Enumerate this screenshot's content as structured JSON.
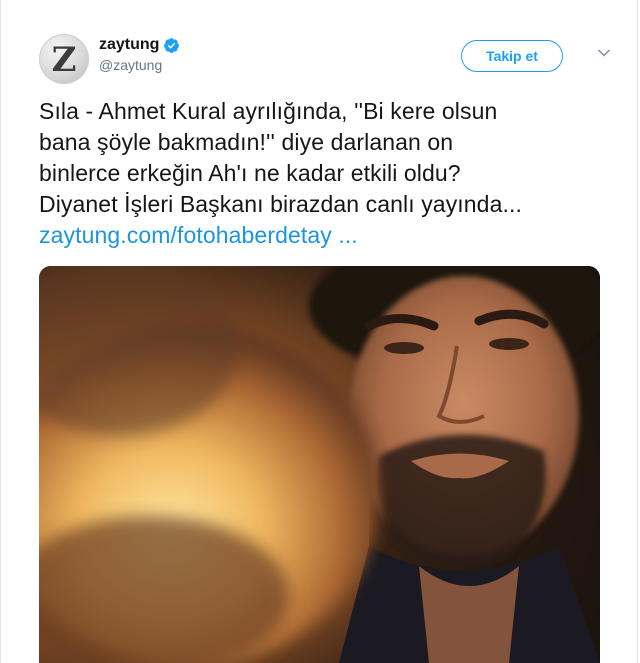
{
  "account": {
    "display_name": "zaytung",
    "handle": "@zaytung",
    "avatar_letter": "Z",
    "verified": true,
    "verified_icon": "verified-badge-icon"
  },
  "actions": {
    "follow_label": "Takip et",
    "menu_icon": "chevron-down-icon"
  },
  "tweet": {
    "lines": [
      "Sıla - Ahmet Kural ayrılığında, ''Bi kere olsun",
      "bana şöyle bakmadın!'' diye darlanan on",
      "binlerce erkeğin Ah'ı ne kadar etkili oldu?",
      "Diyanet İşleri Başkanı birazdan canlı yayında..."
    ],
    "link_text": "zaytung.com/fotohaberdetay ..."
  },
  "colors": {
    "accent": "#1da1f2",
    "link": "#1b95e0",
    "text": "#14171a",
    "secondary_text": "#657786"
  }
}
